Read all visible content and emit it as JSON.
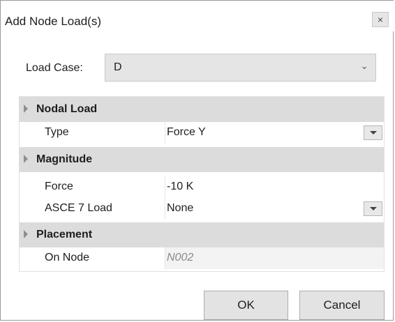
{
  "dialog": {
    "title": "Add Node Load(s)",
    "close_label": "×"
  },
  "load_case": {
    "label": "Load Case:",
    "value": "D",
    "chevron": "⌄"
  },
  "grid": {
    "categories": [
      {
        "label": "Nodal Load",
        "properties": [
          {
            "name": "Type",
            "value": "Force Y",
            "dropdown": true
          }
        ]
      },
      {
        "label": "Magnitude",
        "properties": [
          {
            "name": "Force",
            "value": "-10 K",
            "dropdown": false
          },
          {
            "name": "ASCE 7 Load",
            "value": "None",
            "dropdown": true
          }
        ]
      },
      {
        "label": "Placement",
        "properties": [
          {
            "name": "On Node",
            "value": "N002",
            "dropdown": false,
            "readonly": true
          }
        ]
      }
    ]
  },
  "buttons": {
    "ok": "OK",
    "cancel": "Cancel"
  },
  "colors": {
    "category_bg": "#dcdcdc",
    "combo_bg": "#e5e5e5",
    "button_bg": "#e3e3e3",
    "readonly_text": "#8a8a8a"
  }
}
